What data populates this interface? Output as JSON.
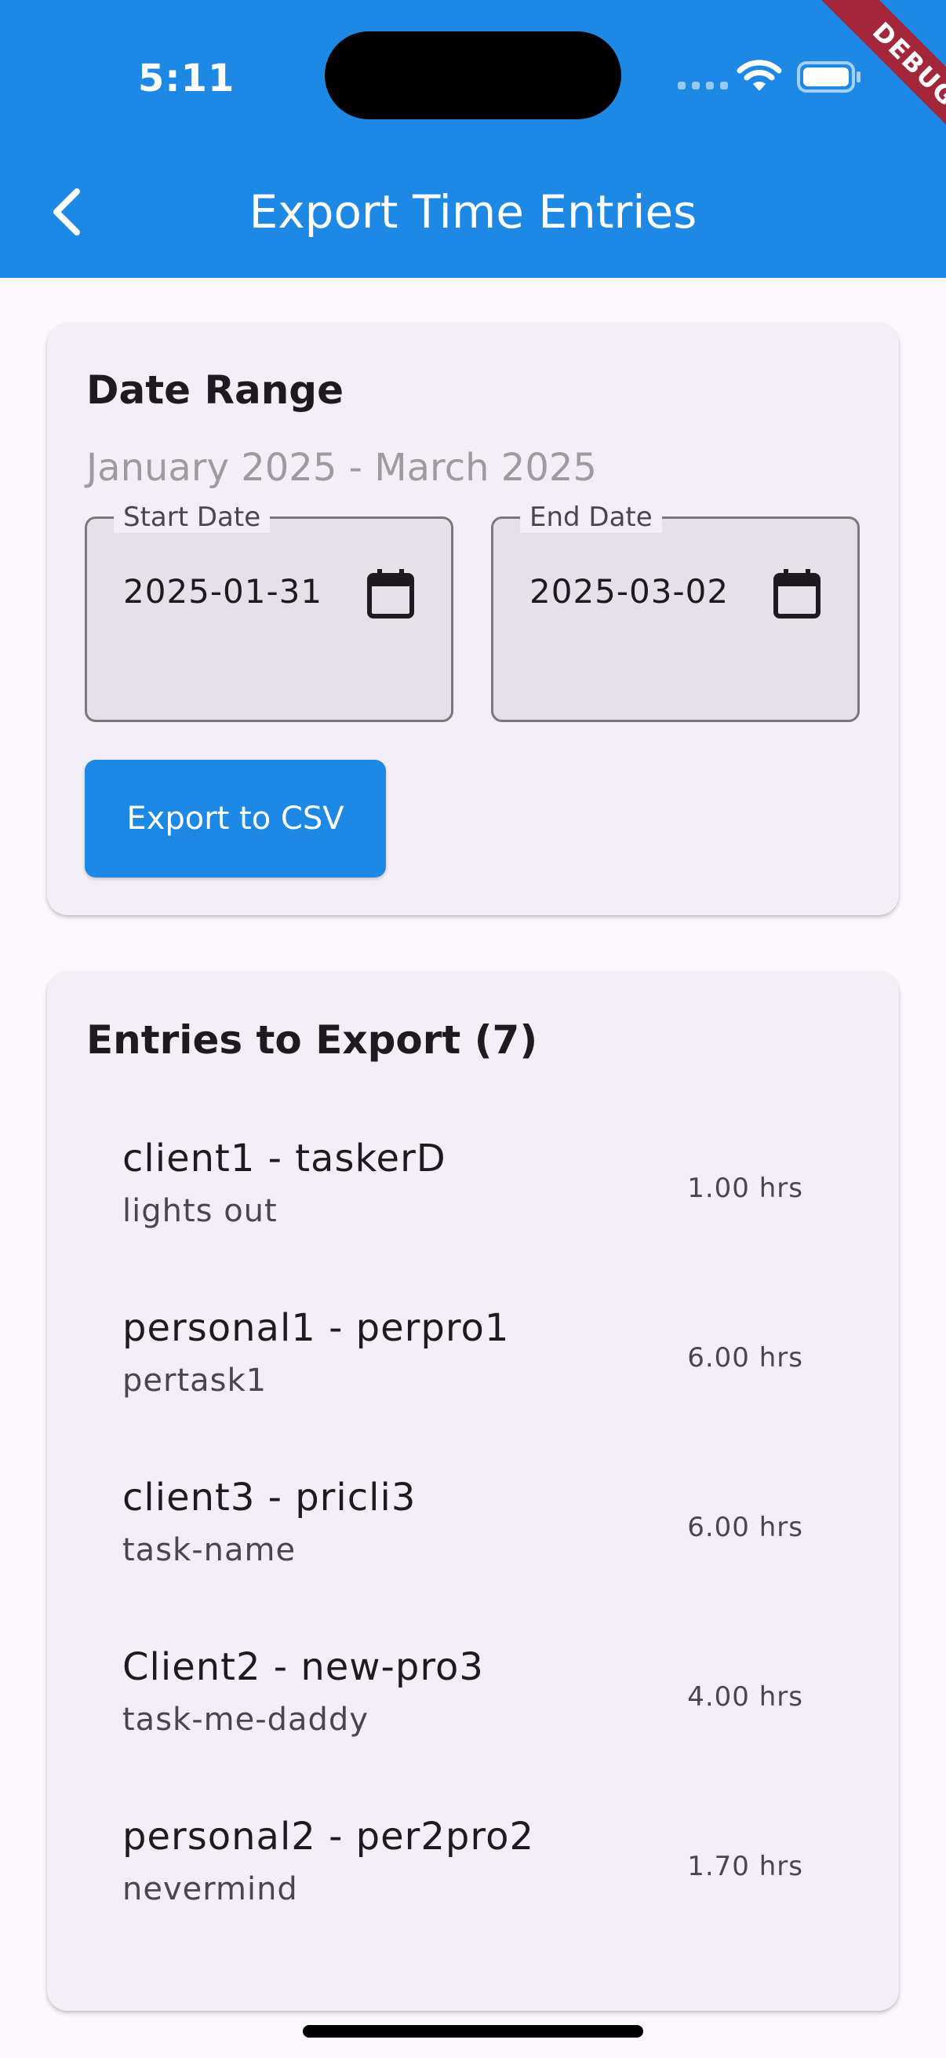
{
  "status_bar": {
    "time": "5:11"
  },
  "debug_banner": "DEBUG",
  "app_bar": {
    "title": "Export Time Entries"
  },
  "date_range_card": {
    "title": "Date Range",
    "range_text": "January 2025 - March 2025",
    "start_field": {
      "label": "Start Date",
      "value": "2025-01-31"
    },
    "end_field": {
      "label": "End Date",
      "value": "2025-03-02"
    },
    "export_label": "Export to CSV"
  },
  "entries_card": {
    "title": "Entries to Export (7)",
    "entries": [
      {
        "title": "client1 - taskerD",
        "subtitle": "lights out",
        "hours": "1.00 hrs"
      },
      {
        "title": "personal1 - perpro1",
        "subtitle": "pertask1",
        "hours": "6.00 hrs"
      },
      {
        "title": "client3 - pricli3",
        "subtitle": "task-name",
        "hours": "6.00 hrs"
      },
      {
        "title": "Client2 - new-pro3",
        "subtitle": "task-me-daddy",
        "hours": "4.00 hrs"
      },
      {
        "title": "personal2 - per2pro2",
        "subtitle": "nevermind",
        "hours": "1.70 hrs"
      }
    ]
  },
  "colors": {
    "primary": "#1E88E5",
    "background": "#FDF7FE",
    "card": "#F4EFF6",
    "field_fill": "#E6E0E8",
    "debug": "#A3263A"
  }
}
